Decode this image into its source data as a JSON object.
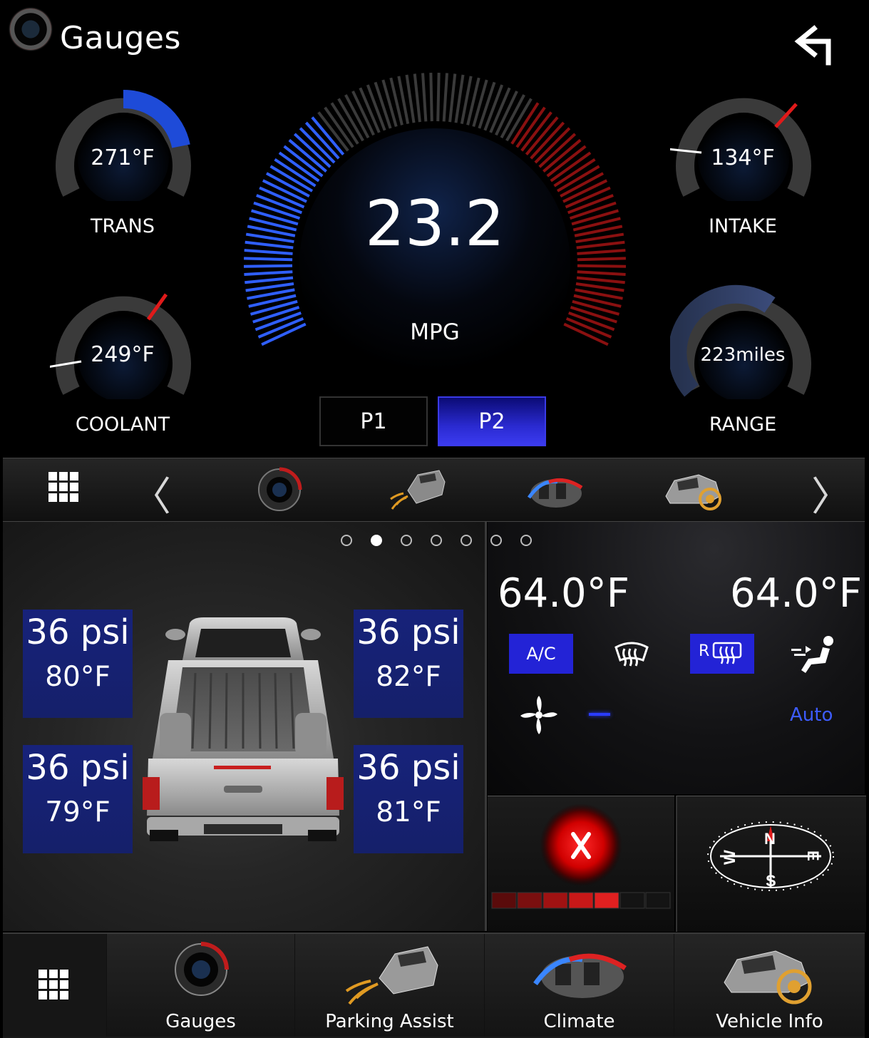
{
  "header": {
    "title": "Gauges",
    "back_icon": "back-arrow-icon"
  },
  "gauges": {
    "trans": {
      "value": "271°F",
      "label": "TRANS"
    },
    "coolant": {
      "value": "249°F",
      "label": "COOLANT"
    },
    "intake": {
      "value": "134°F",
      "label": "INTAKE"
    },
    "range": {
      "value": "223miles",
      "label": "RANGE"
    },
    "mpg": {
      "value": "23.2",
      "unit": "MPG"
    }
  },
  "presets": {
    "p1": "P1",
    "p2": "P2",
    "selected": "P2"
  },
  "carousel": {
    "items": [
      "gauges-icon",
      "parking-assist-icon",
      "climate-icon",
      "vehicle-info-icon"
    ],
    "prev_icon": "chevron-left-icon",
    "next_icon": "chevron-right-icon",
    "menu_icon": "grid-menu-icon"
  },
  "pager": {
    "count": 7,
    "active_index": 1
  },
  "tires": {
    "front_left": {
      "pressure": "36 psi",
      "temp": "80°F"
    },
    "front_right": {
      "pressure": "36 psi",
      "temp": "82°F"
    },
    "rear_left": {
      "pressure": "36 psi",
      "temp": "79°F"
    },
    "rear_right": {
      "pressure": "36 psi",
      "temp": "81°F"
    }
  },
  "climate": {
    "left_temp": "64.0°F",
    "right_temp": "64.0°F",
    "ac_label": "A/C",
    "rear_defrost_label": "R",
    "fan_mode": "Auto"
  },
  "nav": {
    "menu_icon": "grid-menu-icon",
    "items": [
      {
        "label": "Gauges"
      },
      {
        "label": "Parking Assist"
      },
      {
        "label": "Climate"
      },
      {
        "label": "Vehicle Info"
      }
    ]
  },
  "colors": {
    "accent_blue": "#2f5fff",
    "selected_blue": "#2323d6",
    "warning_red": "#c81010"
  }
}
